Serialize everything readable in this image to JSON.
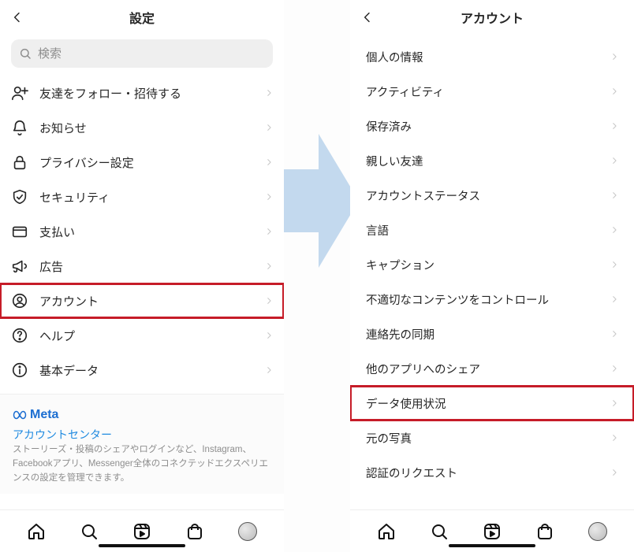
{
  "left": {
    "title": "設定",
    "search_placeholder": "検索",
    "items": [
      {
        "icon": "add-friend-icon",
        "label": "友達をフォロー・招待する"
      },
      {
        "icon": "bell-icon",
        "label": "お知らせ"
      },
      {
        "icon": "lock-icon",
        "label": "プライバシー設定"
      },
      {
        "icon": "shield-icon",
        "label": "セキュリティ"
      },
      {
        "icon": "card-icon",
        "label": "支払い"
      },
      {
        "icon": "megaphone-icon",
        "label": "広告"
      },
      {
        "icon": "user-icon",
        "label": "アカウント",
        "highlight": true
      },
      {
        "icon": "help-icon",
        "label": "ヘルプ"
      },
      {
        "icon": "info-icon",
        "label": "基本データ"
      }
    ],
    "meta_logo": "Meta",
    "meta_link": "アカウントセンター",
    "meta_desc": "ストーリーズ・投稿のシェアやログインなど、Instagram、Facebookアプリ、Messenger全体のコネクテッドエクスペリエンスの設定を管理できます。"
  },
  "right": {
    "title": "アカウント",
    "items": [
      {
        "label": "個人の情報"
      },
      {
        "label": "アクティビティ"
      },
      {
        "label": "保存済み"
      },
      {
        "label": "親しい友達"
      },
      {
        "label": "アカウントステータス"
      },
      {
        "label": "言語"
      },
      {
        "label": "キャプション"
      },
      {
        "label": "不適切なコンテンツをコントロール"
      },
      {
        "label": "連絡先の同期"
      },
      {
        "label": "他のアプリへのシェア"
      },
      {
        "label": "データ使用状況",
        "highlight": true
      },
      {
        "label": "元の写真"
      },
      {
        "label": "認証のリクエスト"
      }
    ]
  }
}
